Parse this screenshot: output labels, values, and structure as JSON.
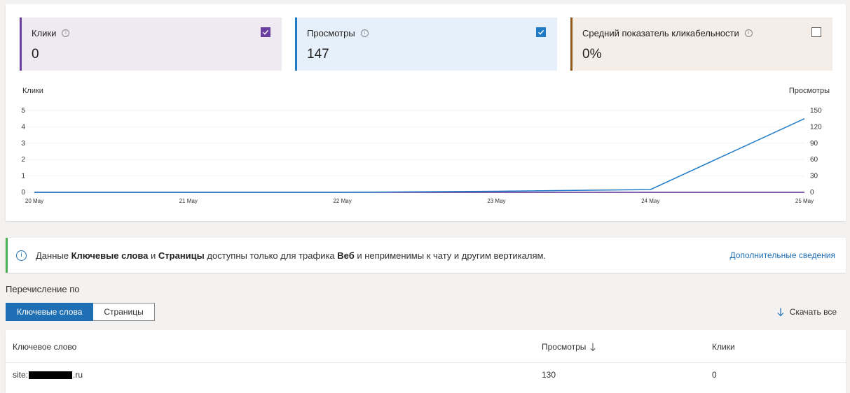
{
  "cards": [
    {
      "label": "Клики",
      "value": "0",
      "checked": true,
      "color": "#6b3fa0"
    },
    {
      "label": "Просмотры",
      "value": "147",
      "checked": true,
      "color": "#1f7bc6"
    },
    {
      "label": "Средний показатель кликабельности",
      "value": "0%",
      "checked": false,
      "color": "#8d5b1b"
    }
  ],
  "chart_data": {
    "type": "line",
    "categories": [
      "20 May",
      "21 May",
      "22 May",
      "23 May",
      "24 May",
      "25 May"
    ],
    "left_axis": {
      "label": "Клики",
      "ticks": [
        "0",
        "1",
        "2",
        "3",
        "4",
        "5"
      ],
      "range": [
        0,
        5
      ]
    },
    "right_axis": {
      "label": "Просмотры",
      "ticks": [
        "0",
        "30",
        "60",
        "90",
        "120",
        "150"
      ],
      "range": [
        0,
        150
      ]
    },
    "series": [
      {
        "name": "Клики",
        "axis": "left",
        "color": "#5c2d91",
        "values": [
          0,
          0,
          0,
          0,
          0,
          0
        ]
      },
      {
        "name": "Просмотры",
        "axis": "right",
        "color": "#1f7bc6",
        "values": [
          0,
          0,
          0,
          2,
          5,
          135
        ]
      }
    ]
  },
  "info": {
    "prefix": "Данные ",
    "kw": "Ключевые слова",
    "and": " и ",
    "pages": "Страницы",
    "middle": " доступны только для трафика ",
    "web": "Веб",
    "suffix": " и неприменимы к чату и другим вертикалям.",
    "more": "Дополнительные сведения"
  },
  "enumerate_label": "Перечисление по",
  "tabs": [
    {
      "label": "Ключевые слова",
      "active": true
    },
    {
      "label": "Страницы",
      "active": false
    }
  ],
  "download_label": "Скачать все",
  "table": {
    "headers": {
      "keyword": "Ключевое слово",
      "views": "Просмотры",
      "clicks": "Клики"
    },
    "rows": [
      {
        "keyword_prefix": "site:",
        "keyword_suffix": ".ru",
        "views": "130",
        "clicks": "0"
      }
    ]
  }
}
